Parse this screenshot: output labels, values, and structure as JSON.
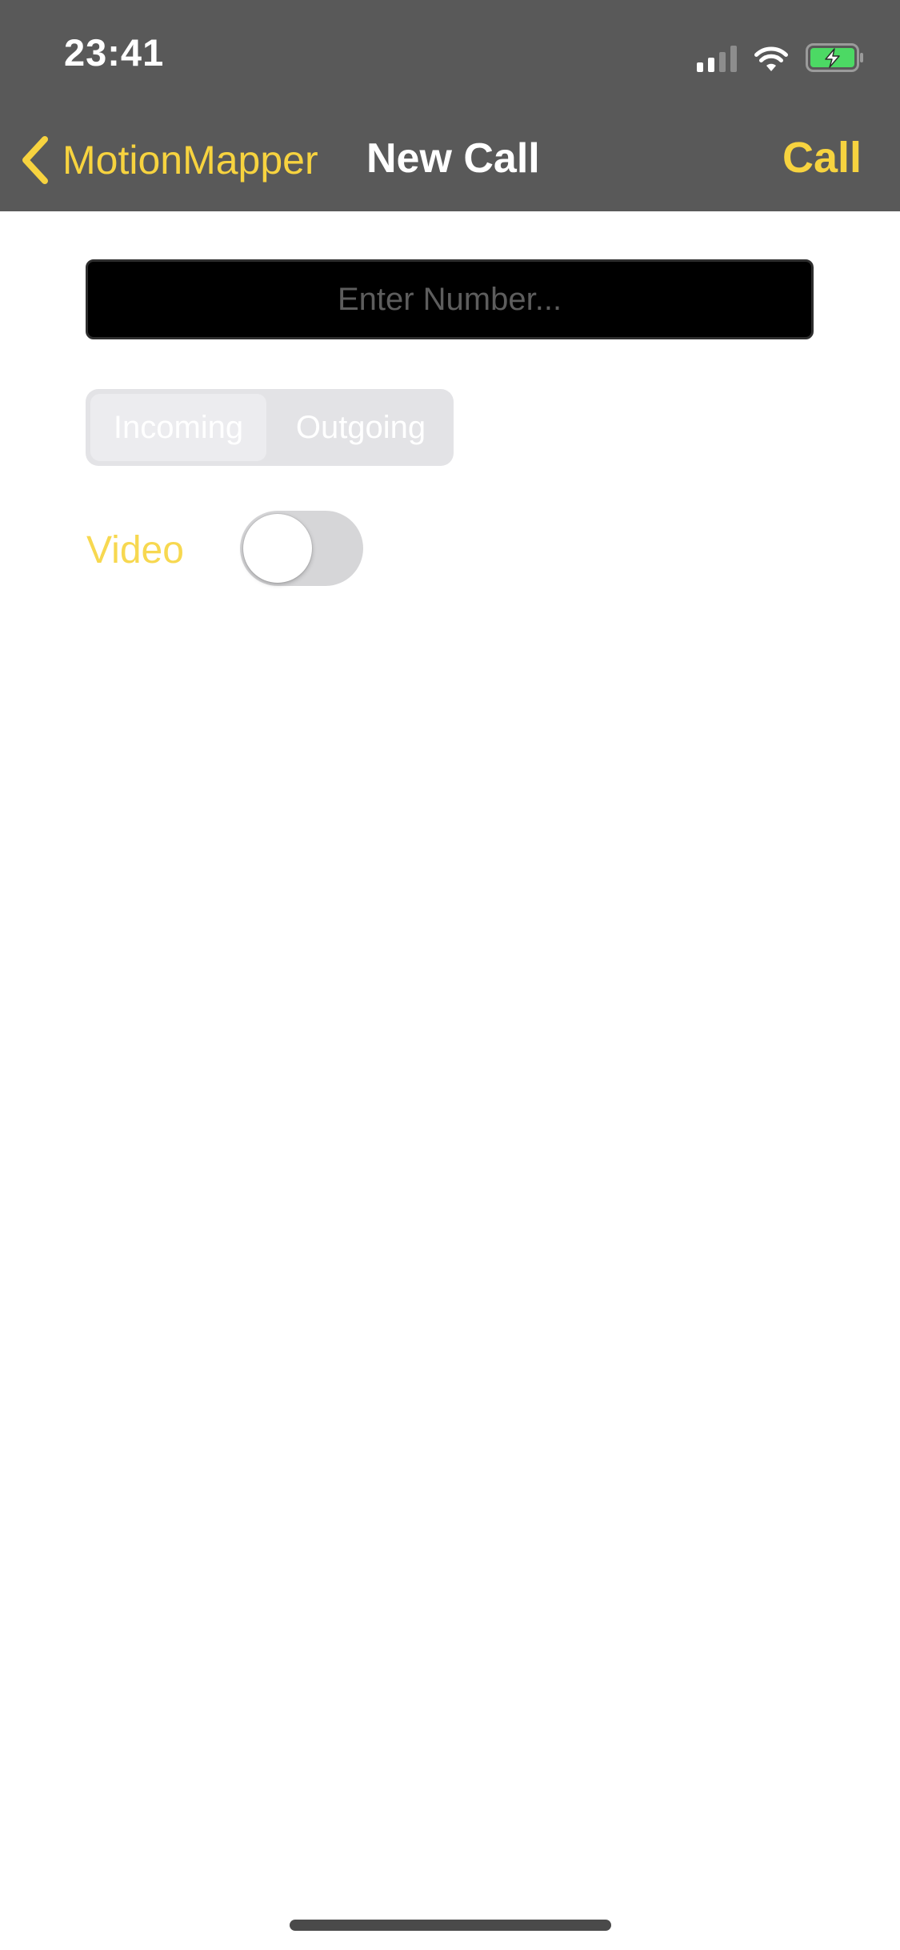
{
  "status_bar": {
    "time": "23:41",
    "icons": [
      "signal-icon",
      "wifi-icon",
      "battery-charging-icon"
    ],
    "battery_color": "#4cd964"
  },
  "nav_bar": {
    "back_label": "MotionMapper",
    "title": "New Call",
    "action_label": "Call"
  },
  "form": {
    "number_input": {
      "value": "",
      "placeholder": "Enter Number..."
    },
    "direction": {
      "options": [
        "Incoming",
        "Outgoing"
      ],
      "selected": "Incoming"
    },
    "video": {
      "label": "Video",
      "enabled": false
    }
  },
  "colors": {
    "accent": "#f7d33f",
    "header_bg": "#595959",
    "background": "#ffffff"
  }
}
